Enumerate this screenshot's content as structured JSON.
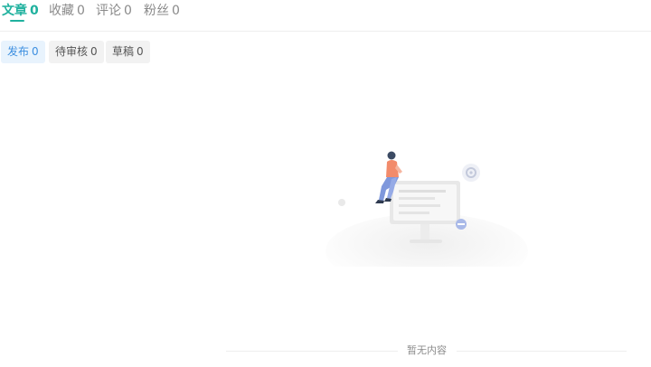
{
  "tabs": [
    {
      "label": "文章",
      "count": "0",
      "active": true
    },
    {
      "label": "收藏",
      "count": "0",
      "active": false
    },
    {
      "label": "评论",
      "count": "0",
      "active": false
    },
    {
      "label": "粉丝",
      "count": "0",
      "active": false
    }
  ],
  "filters": [
    {
      "label": "发布",
      "count": "0",
      "active": true
    },
    {
      "label": "待审核",
      "count": "0",
      "active": false
    },
    {
      "label": "草稿",
      "count": "0",
      "active": false
    }
  ],
  "empty": {
    "text": "暂无内容",
    "illustration": "empty-state-illustration"
  },
  "colors": {
    "accent": "#1fb19e",
    "chip_active_bg": "#e8f3fd",
    "chip_active_text": "#3d8fe0"
  }
}
